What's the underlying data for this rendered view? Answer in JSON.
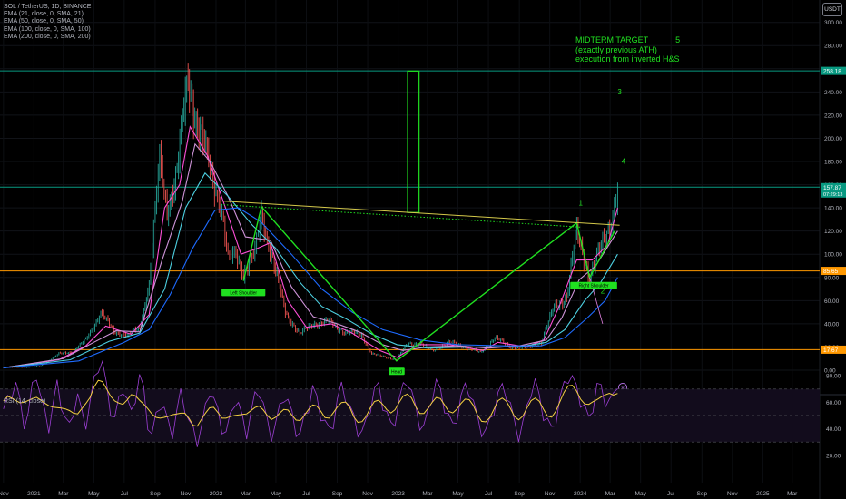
{
  "legend": {
    "symbol": "SOL / TetherUS, 1D, BINANCE",
    "ema": [
      "EMA (21, close, 0, SMA, 21)",
      "EMA (50, close, 0, SMA, 50)",
      "EMA (100, close, 0, SMA, 100)",
      "EMA (200, close, 0, SMA, 200)"
    ],
    "rsi": "RSI (14, close)"
  },
  "currency": "USDT",
  "annotation": {
    "lines": [
      "MIDTERM TARGET",
      "(exactly previous ATH)",
      "execution from inverted H&S"
    ],
    "label_5": "5"
  },
  "wave_labels": [
    "1",
    "2",
    "3",
    "4",
    "5"
  ],
  "chart_data": [
    {
      "type": "candlestick",
      "price_ticks": [
        "300.00",
        "280.00",
        "260.00",
        "240.00",
        "220.00",
        "200.00",
        "180.00",
        "160.00",
        "140.00",
        "120.00",
        "100.00",
        "80.00",
        "60.00",
        "40.00",
        "20.00",
        "0.00"
      ],
      "time_ticks": [
        "Nov",
        "2021",
        "Mar",
        "May",
        "Jul",
        "Sep",
        "Nov",
        "2022",
        "Mar",
        "May",
        "Jul",
        "Sep",
        "Nov",
        "2023",
        "Mar",
        "May",
        "Jul",
        "Sep",
        "Nov",
        "2024",
        "Mar",
        "May",
        "Jul",
        "Sep",
        "Nov",
        "2025",
        "Mar"
      ],
      "price_labels": {
        "target": {
          "value": "258.18",
          "color": "#089981"
        },
        "current": {
          "value": "157.87",
          "sub": "07:29:13",
          "color": "#089981"
        },
        "resistance": {
          "value": "85.65",
          "color": "#ff9800"
        },
        "support": {
          "value": "17.67",
          "color": "#ff9800"
        }
      },
      "pattern_labels": {
        "left_shoulder": "Left Shoulder",
        "head": "Head",
        "right_shoulder": "Right Shoulder"
      },
      "circle_label": "8",
      "price_path": [
        [
          "2020-11-01",
          2
        ],
        [
          "2020-12-15",
          2
        ],
        [
          "2021-01-15",
          4
        ],
        [
          "2021-02-20",
          14
        ],
        [
          "2021-03-20",
          16
        ],
        [
          "2021-04-15",
          26
        ],
        [
          "2021-05-15",
          50
        ],
        [
          "2021-06-10",
          33
        ],
        [
          "2021-07-10",
          30
        ],
        [
          "2021-08-01",
          37
        ],
        [
          "2021-08-20",
          75
        ],
        [
          "2021-09-10",
          180
        ],
        [
          "2021-09-25",
          140
        ],
        [
          "2021-10-15",
          170
        ],
        [
          "2021-11-06",
          255
        ],
        [
          "2021-11-25",
          210
        ],
        [
          "2021-12-20",
          175
        ],
        [
          "2022-01-10",
          145
        ],
        [
          "2022-01-25",
          95
        ],
        [
          "2022-02-10",
          100
        ],
        [
          "2022-02-25",
          85
        ],
        [
          "2022-03-20",
          100
        ],
        [
          "2022-04-02",
          135
        ],
        [
          "2022-04-25",
          95
        ],
        [
          "2022-05-20",
          50
        ],
        [
          "2022-06-18",
          31
        ],
        [
          "2022-07-15",
          40
        ],
        [
          "2022-08-15",
          42
        ],
        [
          "2022-09-15",
          33
        ],
        [
          "2022-10-20",
          31
        ],
        [
          "2022-11-09",
          14
        ],
        [
          "2022-12-29",
          9
        ],
        [
          "2023-01-20",
          23
        ],
        [
          "2023-02-15",
          23
        ],
        [
          "2023-03-10",
          17
        ],
        [
          "2023-04-15",
          24
        ],
        [
          "2023-05-15",
          20
        ],
        [
          "2023-06-15",
          15
        ],
        [
          "2023-07-14",
          28
        ],
        [
          "2023-08-15",
          20
        ],
        [
          "2023-09-15",
          19
        ],
        [
          "2023-10-15",
          24
        ],
        [
          "2023-11-10",
          55
        ],
        [
          "2023-12-05",
          63
        ],
        [
          "2023-12-25",
          120
        ],
        [
          "2024-01-20",
          80
        ],
        [
          "2024-02-15",
          110
        ],
        [
          "2024-03-03",
          130
        ],
        [
          "2024-03-16",
          157
        ]
      ],
      "ema_lines": [
        {
          "name": "EMA 21",
          "color": "#ff4fd8",
          "values": [
            [
              "2020-11-01",
              2
            ],
            [
              "2021-02-20",
              9
            ],
            [
              "2021-04-15",
              21
            ],
            [
              "2021-05-25",
              38
            ],
            [
              "2021-07-15",
              31
            ],
            [
              "2021-08-20",
              48
            ],
            [
              "2021-09-20",
              140
            ],
            [
              "2021-10-20",
              160
            ],
            [
              "2021-11-10",
              210
            ],
            [
              "2021-12-15",
              185
            ],
            [
              "2022-01-20",
              140
            ],
            [
              "2022-02-20",
              100
            ],
            [
              "2022-03-25",
              105
            ],
            [
              "2022-04-20",
              110
            ],
            [
              "2022-05-25",
              60
            ],
            [
              "2022-07-01",
              37
            ],
            [
              "2022-08-20",
              40
            ],
            [
              "2022-10-01",
              32
            ],
            [
              "2022-11-25",
              17
            ],
            [
              "2022-12-30",
              11
            ],
            [
              "2023-02-10",
              22
            ],
            [
              "2023-04-15",
              22
            ],
            [
              "2023-06-20",
              17
            ],
            [
              "2023-07-20",
              24
            ],
            [
              "2023-09-15",
              20
            ],
            [
              "2023-10-20",
              26
            ],
            [
              "2023-11-20",
              55
            ],
            [
              "2023-12-25",
              95
            ],
            [
              "2024-01-25",
              95
            ],
            [
              "2024-02-25",
              108
            ],
            [
              "2024-03-16",
              140
            ]
          ]
        },
        {
          "name": "EMA 50",
          "color": "#ce93d8",
          "values": [
            [
              "2020-11-01",
              2
            ],
            [
              "2021-03-01",
              10
            ],
            [
              "2021-05-01",
              24
            ],
            [
              "2021-06-15",
              34
            ],
            [
              "2021-08-01",
              33
            ],
            [
              "2021-09-15",
              95
            ],
            [
              "2021-10-25",
              145
            ],
            [
              "2021-11-20",
              195
            ],
            [
              "2021-12-20",
              180
            ],
            [
              "2022-01-25",
              150
            ],
            [
              "2022-03-01",
              115
            ],
            [
              "2022-04-20",
              112
            ],
            [
              "2022-06-01",
              72
            ],
            [
              "2022-07-15",
              46
            ],
            [
              "2022-09-01",
              40
            ],
            [
              "2022-10-15",
              33
            ],
            [
              "2022-12-01",
              22
            ],
            [
              "2023-01-10",
              17
            ],
            [
              "2023-03-01",
              20
            ],
            [
              "2023-05-01",
              21
            ],
            [
              "2023-07-01",
              19
            ],
            [
              "2023-09-01",
              21
            ],
            [
              "2023-10-25",
              26
            ],
            [
              "2023-11-25",
              45
            ],
            [
              "2023-12-30",
              78
            ],
            [
              "2024-02-01",
              90
            ],
            [
              "2024-03-16",
              120
            ]
          ]
        },
        {
          "name": "EMA 100",
          "color": "#4dd0e1",
          "values": [
            [
              "2020-11-01",
              2
            ],
            [
              "2021-03-15",
              9
            ],
            [
              "2021-06-01",
              25
            ],
            [
              "2021-08-01",
              32
            ],
            [
              "2021-09-20",
              70
            ],
            [
              "2021-11-01",
              140
            ],
            [
              "2021-12-10",
              170
            ],
            [
              "2022-01-25",
              150
            ],
            [
              "2022-03-15",
              125
            ],
            [
              "2022-05-01",
              105
            ],
            [
              "2022-06-20",
              75
            ],
            [
              "2022-08-01",
              55
            ],
            [
              "2022-09-20",
              44
            ],
            [
              "2022-11-10",
              31
            ],
            [
              "2022-12-30",
              22
            ],
            [
              "2023-03-01",
              19
            ],
            [
              "2023-06-01",
              20
            ],
            [
              "2023-09-01",
              20
            ],
            [
              "2023-10-25",
              24
            ],
            [
              "2023-12-01",
              35
            ],
            [
              "2024-01-10",
              60
            ],
            [
              "2024-02-10",
              75
            ],
            [
              "2024-03-16",
              100
            ]
          ]
        },
        {
          "name": "EMA 200",
          "color": "#1e6bff",
          "values": [
            [
              "2020-11-01",
              2
            ],
            [
              "2021-04-01",
              8
            ],
            [
              "2021-07-01",
              24
            ],
            [
              "2021-08-20",
              35
            ],
            [
              "2021-10-01",
              65
            ],
            [
              "2021-11-15",
              105
            ],
            [
              "2021-12-30",
              138
            ],
            [
              "2022-02-15",
              140
            ],
            [
              "2022-04-01",
              128
            ],
            [
              "2022-06-01",
              100
            ],
            [
              "2022-08-01",
              70
            ],
            [
              "2022-10-01",
              50
            ],
            [
              "2022-12-01",
              35
            ],
            [
              "2023-02-15",
              26
            ],
            [
              "2023-05-01",
              22
            ],
            [
              "2023-08-01",
              21
            ],
            [
              "2023-10-15",
              21
            ],
            [
              "2023-12-01",
              28
            ],
            [
              "2024-01-15",
              45
            ],
            [
              "2024-02-20",
              60
            ],
            [
              "2024-03-16",
              80
            ]
          ]
        }
      ],
      "hs_pattern": [
        [
          "2022-02-25",
          77
        ],
        [
          "2022-04-02",
          141
        ],
        [
          "2022-12-29",
          8
        ],
        [
          "2023-12-25",
          127
        ],
        [
          "2024-01-20",
          80
        ],
        [
          "2024-03-10",
          120
        ]
      ],
      "neckline": [
        [
          "2022-01-10",
          146
        ],
        [
          "2024-03-20",
          125
        ]
      ],
      "target_box": {
        "x0": "2023-01-20",
        "x1": "2023-02-12",
        "y0": 136,
        "y1": 258
      },
      "horizontal_levels": [
        {
          "name": "target",
          "value": 258.18,
          "color": "#089981"
        },
        {
          "name": "current",
          "value": 157.87,
          "color": "#089981"
        },
        {
          "name": "resistance",
          "value": 85.65,
          "color": "#ff9800"
        },
        {
          "name": "support",
          "value": 17.67,
          "color": "#ff9800"
        }
      ]
    },
    {
      "type": "line",
      "name": "RSI (14, close)",
      "ticks": [
        "80.00",
        "60.00",
        "40.00",
        "20.00"
      ],
      "ylim": [
        15,
        95
      ],
      "bands": [
        30,
        70
      ],
      "rsi_values": [
        55,
        60,
        68,
        75,
        58,
        45,
        52,
        70,
        82,
        65,
        50,
        42,
        58,
        72,
        60,
        48,
        40,
        55,
        66,
        50,
        45,
        60,
        75,
        88,
        90,
        70,
        55,
        48,
        60,
        72,
        62,
        50,
        65,
        80,
        68,
        45,
        35,
        48,
        60,
        55,
        42,
        38,
        52,
        66,
        58,
        45,
        38,
        32,
        40,
        55,
        70,
        62,
        52,
        42,
        36,
        48,
        62,
        58,
        46,
        38,
        50,
        64,
        70,
        58,
        44,
        36,
        42,
        55,
        66,
        60,
        50,
        40,
        35,
        48,
        58,
        70,
        62,
        52,
        44,
        38,
        46,
        60,
        72,
        66,
        55,
        48,
        40,
        36,
        45,
        58,
        68,
        72,
        60,
        50,
        42,
        48,
        60,
        72,
        78,
        66,
        55,
        45,
        40,
        52,
        66,
        74,
        68,
        58,
        48,
        42,
        50,
        62,
        72,
        70,
        58,
        48,
        40,
        36,
        46,
        56,
        64,
        72,
        68,
        56,
        44,
        36,
        42,
        56,
        70,
        74,
        64,
        52,
        44,
        40,
        48,
        60,
        74,
        80,
        76,
        72,
        62,
        54,
        48,
        58,
        70,
        72,
        62,
        58,
        66,
        76
      ]
    }
  ]
}
